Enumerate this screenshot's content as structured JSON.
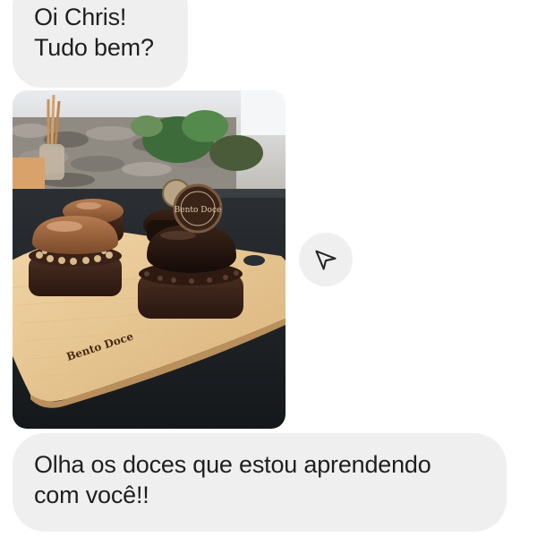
{
  "messages": [
    {
      "type": "text",
      "lines": [
        "Oi Chris!",
        "Tudo bem?"
      ]
    },
    {
      "type": "image",
      "image_text": {
        "board_brand": "Bento Doce",
        "medallion_text": "Bento Doce"
      }
    },
    {
      "type": "text",
      "lines": [
        "Olha os doces que estou aprendendo",
        "com você!!"
      ]
    }
  ],
  "share_button": {
    "icon": "send-icon"
  },
  "colors": {
    "bubble_bg": "#efefef",
    "text": "#1f1f1f",
    "page_bg": "#ffffff"
  }
}
